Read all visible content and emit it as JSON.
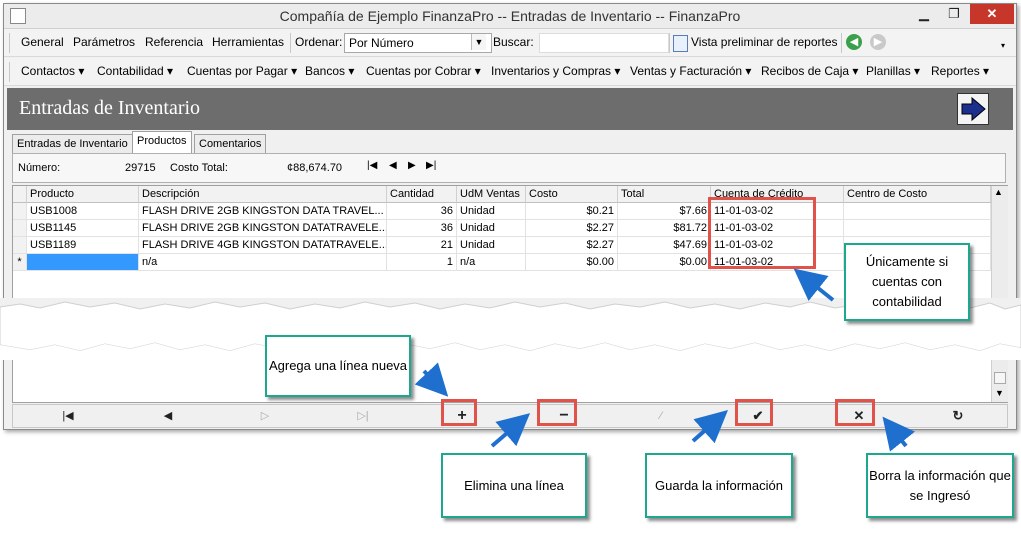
{
  "window": {
    "title": "Compañía de Ejemplo FinanzaPro -- Entradas de Inventario -- FinanzaPro"
  },
  "toolbar": {
    "menu": [
      "General",
      "Parámetros",
      "Referencia",
      "Herramientas"
    ],
    "order_label": "Ordenar:",
    "order_value": "Por Número",
    "search_label": "Buscar:",
    "search_value": "",
    "preview_label": "Vista preliminar de reportes"
  },
  "modules": [
    "Contactos",
    "Contabilidad",
    "Cuentas por Pagar",
    "Bancos",
    "Cuentas por Cobrar",
    "Inventarios y Compras",
    "Ventas y Facturación",
    "Recibos de Caja",
    "Planillas",
    "Reportes"
  ],
  "header": {
    "title": "Entradas de Inventario"
  },
  "tabs": [
    "Entradas de Inventario",
    "Productos",
    "Comentarios"
  ],
  "panel": {
    "numero_label": "Número:",
    "numero_value": "29715",
    "costo_label": "Costo Total:",
    "costo_value": "¢88,674.70"
  },
  "grid": {
    "columns": [
      "Producto",
      "Descripción",
      "Cantidad",
      "UdM Ventas",
      "Costo",
      "Total",
      "Cuenta de Crédito",
      "Centro de Costo"
    ],
    "rows": [
      [
        "USB1008",
        "FLASH DRIVE 2GB KINGSTON DATA TRAVEL...",
        "36",
        "Unidad",
        "$0.21",
        "$7.66",
        "11-01-03-02",
        ""
      ],
      [
        "USB1145",
        "FLASH DRIVE 2GB KINGSTON DATATRAVELE...",
        "36",
        "Unidad",
        "$2.27",
        "$81.72",
        "11-01-03-02",
        ""
      ],
      [
        "USB1189",
        "FLASH DRIVE 4GB KINGSTON DATATRAVELE...",
        "21",
        "Unidad",
        "$2.27",
        "$47.69",
        "11-01-03-02",
        ""
      ],
      [
        "",
        "n/a",
        "1",
        "n/a",
        "$0.00",
        "$0.00",
        "11-01-03-02",
        ""
      ]
    ],
    "new_row_marker": "*"
  },
  "callouts": {
    "contabilidad": "Únicamente si cuentas con contabilidad",
    "agrega": "Agrega una línea nueva",
    "elimina": "Elimina una línea",
    "guarda": "Guarda la información",
    "borra": "Borra la información que se Ingresó"
  },
  "colors": {
    "accent_callout": "#1ca88e",
    "highlight": "#e0534a",
    "header_bg": "#6d6d6d",
    "arrow": "#1f6fcf"
  }
}
